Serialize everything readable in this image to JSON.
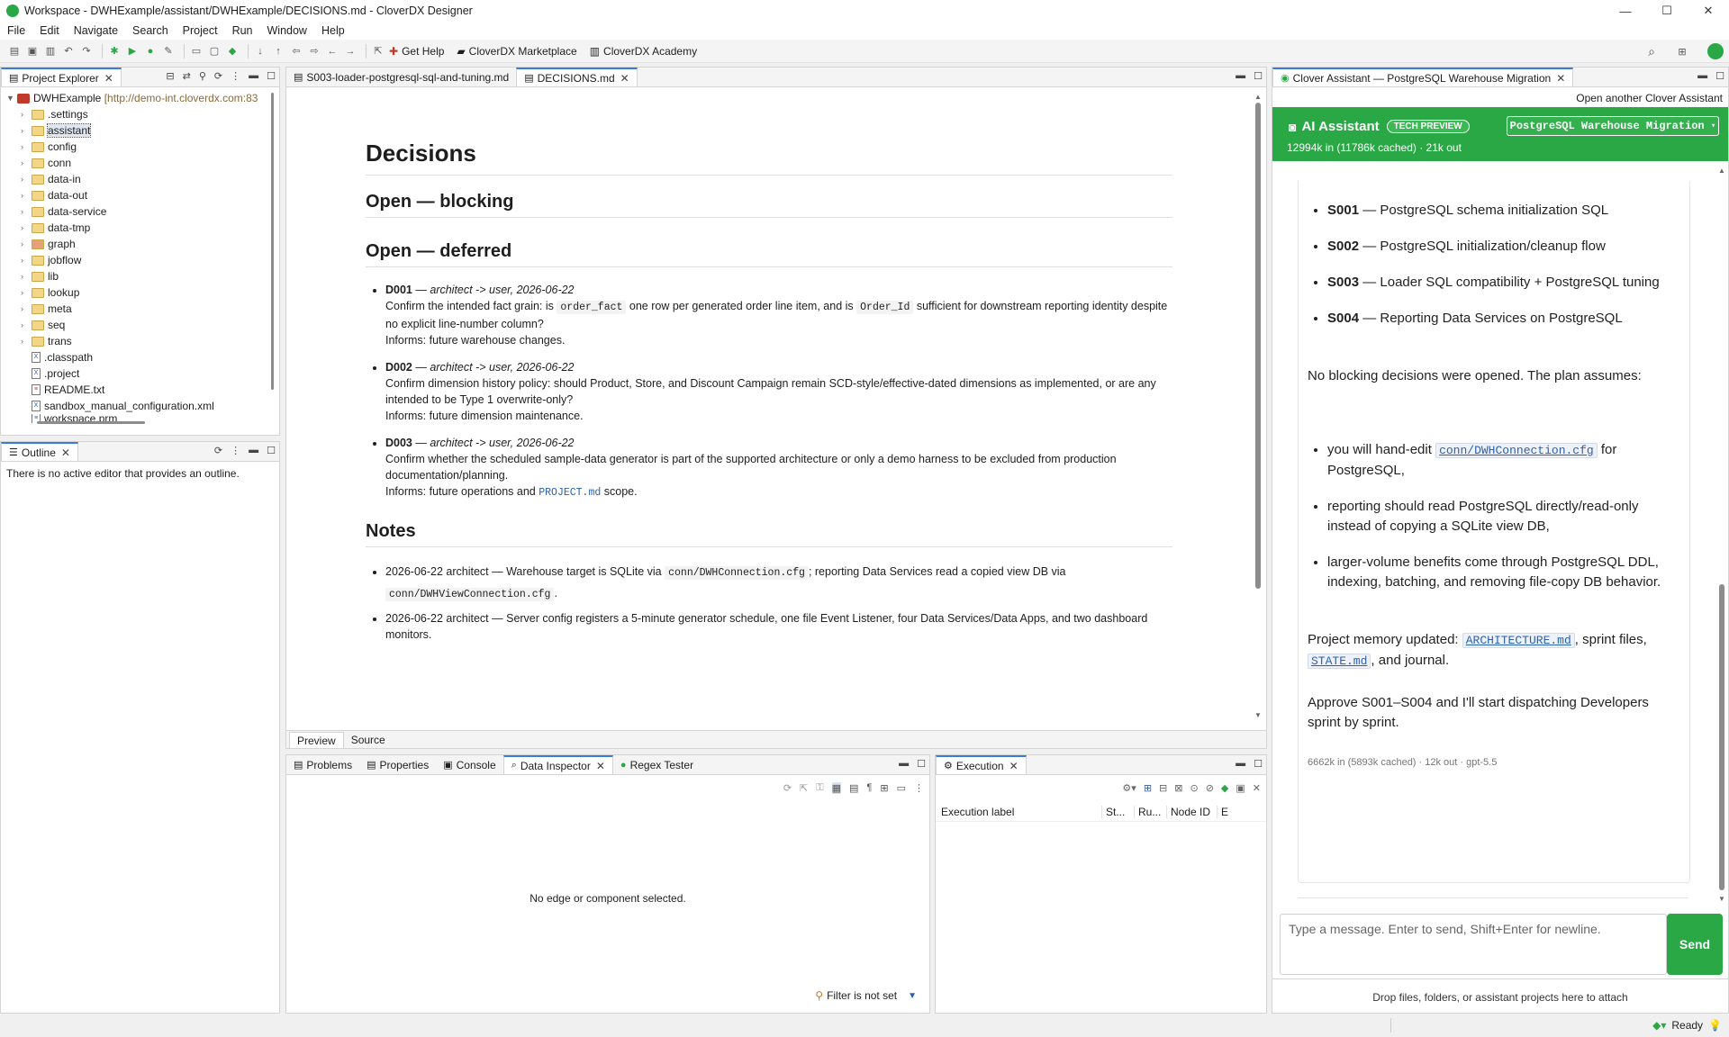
{
  "window": {
    "title": "Workspace - DWHExample/assistant/DWHExample/DECISIONS.md - CloverDX Designer"
  },
  "menu": [
    "File",
    "Edit",
    "Navigate",
    "Search",
    "Project",
    "Run",
    "Window",
    "Help"
  ],
  "toolbar": {
    "get_help": "Get Help",
    "marketplace": "CloverDX Marketplace",
    "academy": "CloverDX Academy"
  },
  "project_explorer": {
    "tab": "Project Explorer",
    "root": "DWHExample",
    "root_url": "[http://demo-int.cloverdx.com:83",
    "items": [
      ".settings",
      "assistant",
      "config",
      "conn",
      "data-in",
      "data-out",
      "data-service",
      "data-tmp",
      "graph",
      "jobflow",
      "lib",
      "lookup",
      "meta",
      "seq",
      "trans",
      ".classpath",
      ".project",
      "README.txt",
      "sandbox_manual_configuration.xml",
      "workspace.prm"
    ]
  },
  "outline": {
    "tab": "Outline",
    "message": "There is no active editor that provides an outline."
  },
  "editor": {
    "tabs": [
      "S003-loader-postgresql-sql-and-tuning.md",
      "DECISIONS.md"
    ],
    "h1": "Decisions",
    "h2_blocking": "Open — blocking",
    "h2_deferred": "Open — deferred",
    "decisions": [
      {
        "id": "D001",
        "meta": "— architect -> user, 2026-06-22",
        "line1_pre": "Confirm the intended fact grain: is",
        "code1": "order_fact",
        "line1_mid": "one row per generated order line item, and is",
        "code2": "Order_Id",
        "line1_post": "sufficient for downstream reporting identity despite no explicit line-number column?",
        "informs": "Informs: future warehouse changes."
      },
      {
        "id": "D002",
        "meta": "— architect -> user, 2026-06-22",
        "text": "Confirm dimension history policy: should Product, Store, and Discount Campaign remain SCD-style/effective-dated dimensions as implemented, or are any intended to be Type 1 overwrite-only?",
        "informs": "Informs: future dimension maintenance."
      },
      {
        "id": "D003",
        "meta": "— architect -> user, 2026-06-22",
        "text": "Confirm whether the scheduled sample-data generator is part of the supported architecture or only a demo harness to be excluded from production documentation/planning.",
        "informs_pre": "Informs: future operations and",
        "informs_code": "PROJECT.md",
        "informs_post": "scope."
      }
    ],
    "h2_notes": "Notes",
    "notes": [
      {
        "pre": "2026-06-22 architect — Warehouse target is SQLite via",
        "code": "conn/DWHConnection.cfg",
        "mid": "; reporting Data Services read a copied view DB via",
        "code2": "conn/DWHViewConnection.cfg",
        "post": "."
      },
      {
        "text": "2026-06-22 architect — Server config registers a 5-minute generator schedule, one file Event Listener, four Data Services/Data Apps, and two dashboard monitors."
      }
    ],
    "bottom_tabs": [
      "Preview",
      "Source"
    ]
  },
  "bottom_panel": {
    "tabs": [
      "Problems",
      "Properties",
      "Console",
      "Data Inspector",
      "Regex Tester"
    ],
    "empty": "No edge or component selected.",
    "filter": "Filter is not set"
  },
  "execution": {
    "tab": "Execution",
    "columns": [
      "Execution label",
      "St...",
      "Ru...",
      "Node ID",
      "E"
    ]
  },
  "assistant": {
    "tab": "Clover Assistant — PostgreSQL Warehouse Migration",
    "open_another": "Open another Clover Assistant",
    "header_title": "AI Assistant",
    "badge": "TECH PREVIEW",
    "project_select": "PostgreSQL Warehouse Migration",
    "tokens": "12994k in (11786k cached) · 21k out",
    "sprints": [
      {
        "id": "S001",
        "text": "— PostgreSQL schema initialization SQL"
      },
      {
        "id": "S002",
        "text": "— PostgreSQL initialization/cleanup flow"
      },
      {
        "id": "S003",
        "text": "— Loader SQL compatibility + PostgreSQL tuning"
      },
      {
        "id": "S004",
        "text": "— Reporting Data Services on PostgreSQL"
      }
    ],
    "no_blocking": "No blocking decisions were opened. The plan assumes:",
    "assumption1_pre": "you will hand-edit",
    "assumption1_code": "conn/DWHConnection.cfg",
    "assumption1_post": "for PostgreSQL,",
    "assumption2": "reporting should read PostgreSQL directly/read-only instead of copying a SQLite view DB,",
    "assumption3": "larger-volume benefits come through PostgreSQL DDL, indexing, batching, and removing file-copy DB behavior.",
    "memory_pre": "Project memory updated:",
    "memory_code1": "ARCHITECTURE.md",
    "memory_mid": ", sprint files,",
    "memory_code2": "STATE.md",
    "memory_post": ", and journal.",
    "approve": "Approve S001–S004 and I'll start dispatching Developers sprint by sprint.",
    "msg_tokens": "6662k in (5893k cached) · 12k out · gpt-5.5",
    "input_placeholder": "Type a message. Enter to send, Shift+Enter for newline.",
    "send": "Send",
    "drop_hint": "Drop files, folders, or assistant projects here to attach"
  },
  "status": {
    "ready": "Ready"
  },
  "colors": {
    "accent_green": "#2aa845",
    "link_blue": "#2b62b0",
    "tab_blue": "#3b7ad9"
  }
}
